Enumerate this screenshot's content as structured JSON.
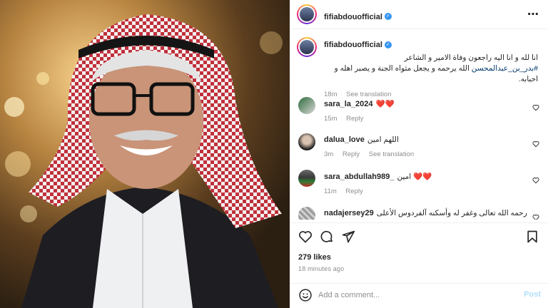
{
  "post": {
    "author": "fifiabdouofficial",
    "author_verified": true,
    "more_icon": "more-horizontal-icon"
  },
  "caption": {
    "username": "fifiabdouofficial",
    "text": "انا لله و انا اليه راجعون وفاة الامير و الشاعر",
    "hashtag": "#بدر_بن_عبدالمحسن",
    "text_rest": " الله يرحمه و يجعل مثواه الجنة و يصبر اهله و احبابه.",
    "time": "18m",
    "see_translation": "See translation"
  },
  "comments": [
    {
      "username": "sara_la_2024",
      "text": "❤️❤️",
      "time": "15m",
      "reply": "Reply",
      "see_translation": ""
    },
    {
      "username": "dalua_love",
      "text": "اللهم امين",
      "time": "3m",
      "reply": "Reply",
      "see_translation": "See translation"
    },
    {
      "username": "sara_abdullah989_",
      "text": "امين ❤️❤️",
      "time": "11m",
      "reply": "Reply",
      "see_translation": ""
    },
    {
      "username": "nadajersey29",
      "text": "رحمه الله تعالى وغفر له وأسكنه آلفردوس الأعلى",
      "time": "",
      "reply": "",
      "see_translation": ""
    }
  ],
  "likes": "279 likes",
  "timestamp": "18 minutes ago",
  "add_comment": {
    "placeholder": "Add a comment...",
    "post_label": "Post"
  },
  "colors": {
    "link_blue": "#00376b",
    "verified_blue": "#3897f0",
    "post_disabled": "#b2dffc",
    "heart_red": "#ed4956"
  }
}
